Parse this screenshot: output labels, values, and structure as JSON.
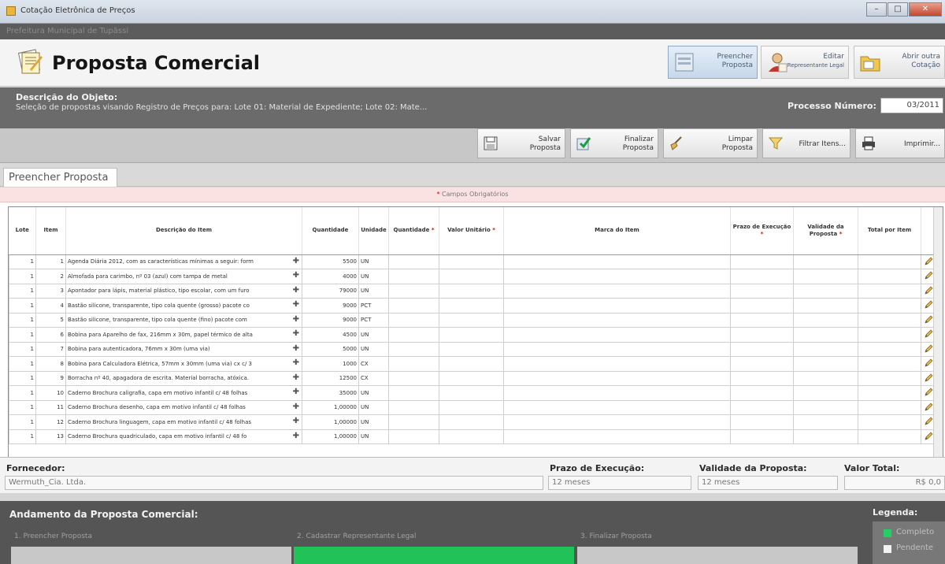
{
  "window": {
    "title": "Cotação Eletrônica de Preços",
    "subtitle": "Prefeitura Municipal de Tupãssi"
  },
  "header": {
    "page_title": "Proposta Comercial",
    "buttons": [
      {
        "line1": "Preencher",
        "line2": "Proposta",
        "icon": "form-icon"
      },
      {
        "line1": "Editar",
        "line2": "Representante Legal",
        "icon": "person-icon"
      },
      {
        "line1": "Abrir outra",
        "line2": "Cotação",
        "icon": "folder-icon"
      }
    ]
  },
  "object": {
    "label": "Descrição do Objeto:",
    "text": "Seleção de propostas visando Registro de Preços para: Lote 01: Material de Expediente; Lote 02: Mate...",
    "process_label": "Processo Número:",
    "process_value": "03/2011"
  },
  "toolbar": {
    "save": {
      "line1": "Salvar",
      "line2": "Proposta"
    },
    "finalize": {
      "line1": "Finalizar",
      "line2": "Proposta"
    },
    "clear": {
      "line1": "Limpar",
      "line2": "Proposta"
    },
    "filter": {
      "label": "Filtrar Itens..."
    },
    "print": {
      "label": "Imprimir..."
    }
  },
  "tab": {
    "label": "Preencher Proposta"
  },
  "required_note": {
    "star": "*",
    "text": " Campos Obrigatórios"
  },
  "grid": {
    "headers": {
      "lote": "Lote",
      "item": "Item",
      "descricao": "Descrição do Item",
      "quantidade": "Quantidade",
      "unidade": "Unidade",
      "quantidade2": "Quantidade",
      "valor_unitario": "Valor Unitário",
      "marca": "Marca do Item",
      "prazo": "Prazo de Execução",
      "validade": "Validade da Proposta",
      "total": "Total por Item",
      "required_star": "*"
    },
    "rows": [
      {
        "lote": "1",
        "item": "1",
        "desc": "Agenda Diária 2012, com as características mínimas a seguir: form",
        "qtd": "5500",
        "un": "UN"
      },
      {
        "lote": "1",
        "item": "2",
        "desc": "Almofada para carimbo, nº 03 (azul) com tampa de metal",
        "qtd": "4000",
        "un": "UN"
      },
      {
        "lote": "1",
        "item": "3",
        "desc": "Apontador para lápis, material plástico, tipo escolar, com um furo",
        "qtd": "79000",
        "un": "UN"
      },
      {
        "lote": "1",
        "item": "4",
        "desc": "Bastão silicone, transparente, tipo cola quente (grosso) pacote co",
        "qtd": "9000",
        "un": "PCT"
      },
      {
        "lote": "1",
        "item": "5",
        "desc": "Bastão silicone, transparente, tipo cola quente (fino) pacote com",
        "qtd": "9000",
        "un": "PCT"
      },
      {
        "lote": "1",
        "item": "6",
        "desc": "Bobina para Aparelho de fax, 216mm x 30m, papel térmico de alta",
        "qtd": "4500",
        "un": "UN"
      },
      {
        "lote": "1",
        "item": "7",
        "desc": "Bobina para autenticadora, 76mm x 30m (uma via)",
        "qtd": "5000",
        "un": "UN"
      },
      {
        "lote": "1",
        "item": "8",
        "desc": "Bobina para Calculadora Elétrica, 57mm x 30mm (uma via) cx c/ 3",
        "qtd": "1000",
        "un": "CX"
      },
      {
        "lote": "1",
        "item": "9",
        "desc": "Borracha nº 40, apagadora de escrita. Material borracha, atóxica.",
        "qtd": "12500",
        "un": "CX"
      },
      {
        "lote": "1",
        "item": "10",
        "desc": "Caderno Brochura caligrafia, capa em motivo infantil c/ 48 folhas",
        "qtd": "35000",
        "un": "UN"
      },
      {
        "lote": "1",
        "item": "11",
        "desc": "Caderno Brochura desenho, capa em motivo infantil c/ 48 folhas",
        "qtd": "1,00000",
        "un": "UN"
      },
      {
        "lote": "1",
        "item": "12",
        "desc": "Caderno Brochura linguagem, capa em motivo infantil c/ 48 folhas",
        "qtd": "1,00000",
        "un": "UN"
      },
      {
        "lote": "1",
        "item": "13",
        "desc": "Caderno Brochura quadriculado, capa em motivo infantil c/ 48 fo",
        "qtd": "1,00000",
        "un": "UN"
      }
    ]
  },
  "fields": {
    "fornecedor_label": "Fornecedor:",
    "fornecedor_value": "Wermuth_Cia. Ltda.",
    "prazo_label": "Prazo de Execução:",
    "prazo_value": "12 meses",
    "validade_label": "Validade da Proposta:",
    "validade_value": "12 meses",
    "total_label": "Valor Total:",
    "total_value": "R$ 0,0"
  },
  "progress": {
    "title": "Andamento da Proposta Comercial:",
    "steps": [
      {
        "label": "1. Preencher Proposta",
        "done": false
      },
      {
        "label": "2. Cadastrar Representante Legal",
        "done": true
      },
      {
        "label": "3. Finalizar Proposta",
        "done": false
      }
    ],
    "legend_title": "Legenda:",
    "legend_completed": "Completo",
    "legend_pending": "Pendente"
  },
  "colors": {
    "completed": "#21c257",
    "pending": "#c8c8c8",
    "required": "#dd0000"
  }
}
